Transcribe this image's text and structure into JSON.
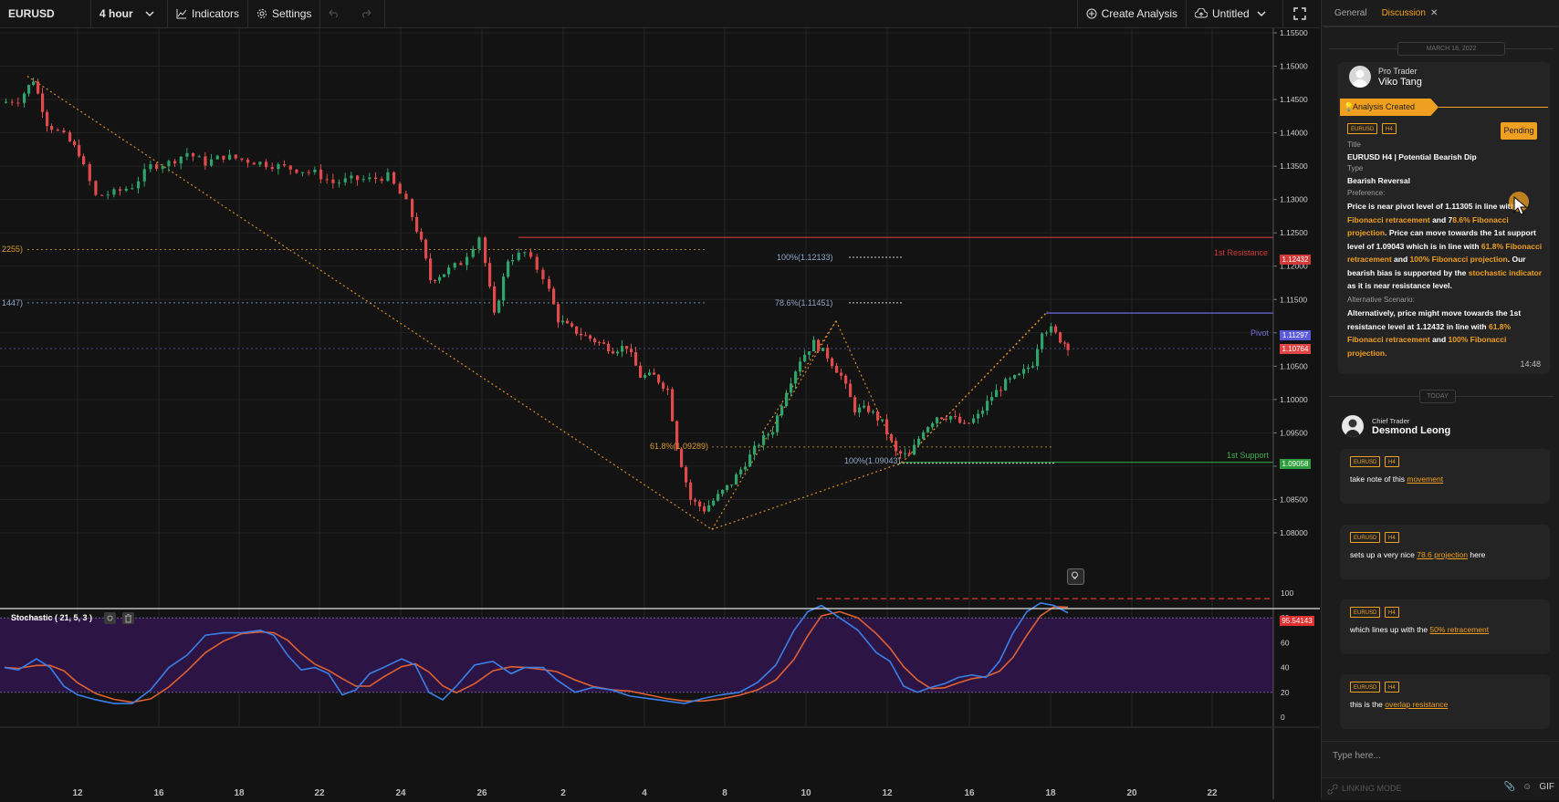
{
  "toolbar": {
    "symbol": "EURUSD",
    "interval": "4 hour",
    "indicators": "Indicators",
    "settings": "Settings",
    "create_analysis": "Create Analysis",
    "layout_name": "Untitled"
  },
  "chart": {
    "price_ticks": [
      "1.15500",
      "1.15000",
      "1.14500",
      "1.14000",
      "1.13500",
      "1.13000",
      "1.12500",
      "1.12000",
      "1.11500",
      "1.11000",
      "1.10500",
      "1.10000",
      "1.09500",
      "1.09000",
      "1.08500",
      "1.08000"
    ],
    "time_ticks": [
      "12",
      "16",
      "18",
      "22",
      "24",
      "26",
      "2",
      "4",
      "8",
      "10",
      "12",
      "16",
      "18",
      "20",
      "22"
    ],
    "levels": {
      "resistance_label": "1st Resistance",
      "resistance_value": "1.12432",
      "pivot_label": "Pivot",
      "pivot_value": "1.11297",
      "current_value": "1.10764",
      "support_label": "1st Support",
      "support_value": "1.09058"
    },
    "fib_labels": {
      "f100_top": "100%(1.12133)",
      "f786": "78.6%(1.11451)",
      "f618": "61.8%(1.09289)",
      "f100_bottom": "100%(1.09043)",
      "left_a": "2255)",
      "left_b": "1447)"
    },
    "stochastic": {
      "title": "Stochastic ( 21, 5, 3 )",
      "ticks": [
        "100",
        "80",
        "60",
        "40",
        "20",
        "0"
      ],
      "current_value": "95.54143"
    }
  },
  "panel": {
    "tabs": [
      "General",
      "Discussion"
    ],
    "date_header": "MARCH 18, 2022",
    "today_header": "TODAY",
    "analysis": {
      "role": "Pro Trader",
      "author": "Viko Tang",
      "status_banner": "Analysis Created",
      "tag_symbol": "EURUSD",
      "tag_tf": "H4",
      "status": "Pending",
      "title_label": "Title",
      "title_value": "EURUSD H4 | Potential Bearish Dip",
      "type_label": "Type",
      "type_value": "Bearish Reversal",
      "preference_label": "Preference:",
      "alt_label": "Alternative Scenario:",
      "time": "14:48"
    },
    "chief": {
      "role": "Chief Trader",
      "name": "Desmond Leong"
    },
    "messages": [
      {
        "pre": "take note of this ",
        "link": "movement",
        "post": ""
      },
      {
        "pre": "sets up a very nice ",
        "link": "78.6 projection",
        "post": " here"
      },
      {
        "pre": "which lines up with the ",
        "link": "50% retracement",
        "post": ""
      },
      {
        "pre": "this is the ",
        "link": "overlap resistance",
        "post": ""
      }
    ],
    "compose_placeholder": "Type here...",
    "linking_mode": "LINKING MODE",
    "gif": "GIF"
  }
}
